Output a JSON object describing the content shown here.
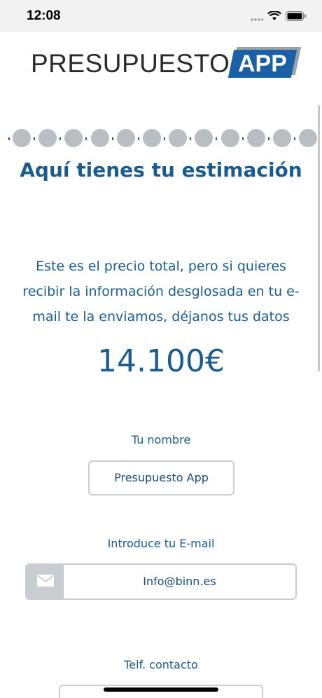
{
  "status_bar": {
    "time": "12:08",
    "icons": [
      "signal-icon",
      "wifi-icon",
      "battery-icon"
    ]
  },
  "logo": {
    "text": "PRESUPUESTO",
    "badge": "APP"
  },
  "progress": {
    "steps_total": 12,
    "dot_color": "#b9bec3"
  },
  "content": {
    "title": "Aquí tienes tu estimación",
    "description_lines": [
      "Este es el precio total, pero si quieres",
      "recibir la información desglosada en tu e-",
      "mail te la enviamos, déjanos tus datos"
    ],
    "price": "14.100€"
  },
  "form": {
    "name_label": "Tu nombre",
    "name_value": "Presupuesto App",
    "email_label": "Introduce tu E-mail",
    "email_value": "Info@binn.es",
    "phone_label": "Telf. contacto"
  },
  "colors": {
    "primary": "#1a5c8f",
    "brand_blue": "#1b5fa5",
    "border": "#c9cdd1"
  }
}
